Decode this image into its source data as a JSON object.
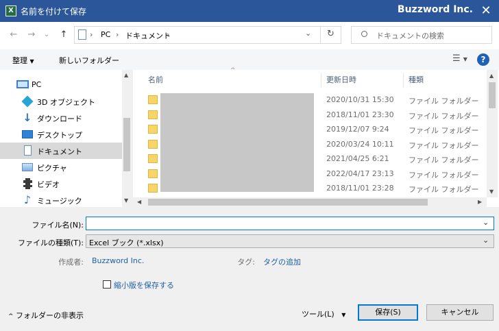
{
  "titlebar": {
    "app_icon": "X",
    "title": "名前を付けて保存",
    "company": "Buzzword Inc.",
    "close": "✕"
  },
  "address": {
    "back": "←",
    "forward": "→",
    "recent": "⌄",
    "up": "↑",
    "segments": [
      "PC",
      "ドキュメント"
    ],
    "dropdown": "⌄",
    "refresh": "↻"
  },
  "search": {
    "placeholder": "ドキュメントの検索"
  },
  "toolbar": {
    "organize": "整理",
    "new_folder": "新しいフォルダー",
    "view": "☰",
    "help": "?"
  },
  "nav": {
    "items": [
      {
        "label": "PC",
        "icon": "pc-icon"
      },
      {
        "label": "3D オブジェクト",
        "icon": "3d-objects-icon"
      },
      {
        "label": "ダウンロード",
        "icon": "download-icon"
      },
      {
        "label": "デスクトップ",
        "icon": "desktop-icon"
      },
      {
        "label": "ドキュメント",
        "icon": "documents-icon"
      },
      {
        "label": "ピクチャ",
        "icon": "pictures-icon"
      },
      {
        "label": "ビデオ",
        "icon": "video-icon"
      },
      {
        "label": "ミュージック",
        "icon": "music-icon"
      }
    ]
  },
  "files": {
    "columns": {
      "name": "名前",
      "modified": "更新日時",
      "type": "種類"
    },
    "rows": [
      {
        "date": "2020/10/31 15:30",
        "type": "ファイル フォルダー"
      },
      {
        "date": "2018/11/01 23:30",
        "type": "ファイル フォルダー"
      },
      {
        "date": "2019/12/07 9:24",
        "type": "ファイル フォルダー"
      },
      {
        "date": "2020/03/24 10:11",
        "type": "ファイル フォルダー"
      },
      {
        "date": "2021/04/25 6:21",
        "type": "ファイル フォルダー"
      },
      {
        "date": "2022/04/17 23:13",
        "type": "ファイル フォルダー"
      },
      {
        "date": "2018/11/01 23:28",
        "type": "ファイル フォルダー"
      }
    ]
  },
  "form": {
    "filename_label": "ファイル名(N):",
    "filename_value": "",
    "filetype_label": "ファイルの種類(T):",
    "filetype_value": "Excel ブック (*.xlsx)",
    "author_label": "作成者:",
    "author_value": "Buzzword Inc.",
    "tags_label": "タグ:",
    "tags_value": "タグの追加",
    "thumbnail_label": "縮小版を保存する"
  },
  "footer": {
    "hide_folders": "フォルダーの非表示",
    "tools": "ツール(L)",
    "save": "保存(S)",
    "cancel": "キャンセル"
  }
}
